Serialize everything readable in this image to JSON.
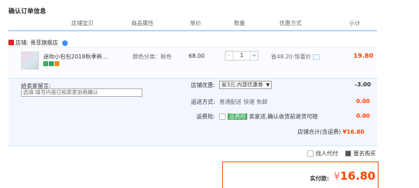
{
  "title": "确认订单信息",
  "headers": [
    "店铺宝贝",
    "商品属性",
    "单价",
    "数量",
    "优惠方式",
    "小计"
  ],
  "shop": {
    "label": "店铺:",
    "name": "贵菲旗舰店"
  },
  "item": {
    "title": "迷你小包包2018秋季新...",
    "attr": "颜色分类：粉色",
    "price": "68.00",
    "quantity": "1",
    "qty_minus": "-",
    "qty_plus": "+",
    "promo": "省48.20:惊喜价",
    "subtotal": "19.80"
  },
  "memo": {
    "label": "给卖家留言:",
    "placeholder": "选填:填写内容已和卖家协商确认"
  },
  "options": {
    "shop_discount_label": "店铺优惠:",
    "shop_discount_value": "省3元:内部优惠券",
    "shop_discount_amount": "-3.00",
    "shipping_label": "运送方式:",
    "shipping_value": "普通配送 快递 免邮",
    "shipping_amount": "0.00",
    "insurance_label": "运费险:",
    "insurance_tag": "运费险",
    "insurance_value": "卖家送,确认收货前退货可赔",
    "insurance_amount": "0.00"
  },
  "total": {
    "label": "店铺合计(含运费)",
    "value": "¥16.80"
  },
  "checks": {
    "proxy_pay": "找人代付",
    "anonymous": "匿名购买"
  },
  "pay": {
    "label": "实付款:",
    "currency": "¥",
    "amount": "16.80"
  },
  "colors": {
    "accent": "#ff4400",
    "header_line": "#b2d1ff",
    "options_bg": "#f2f7ff"
  }
}
